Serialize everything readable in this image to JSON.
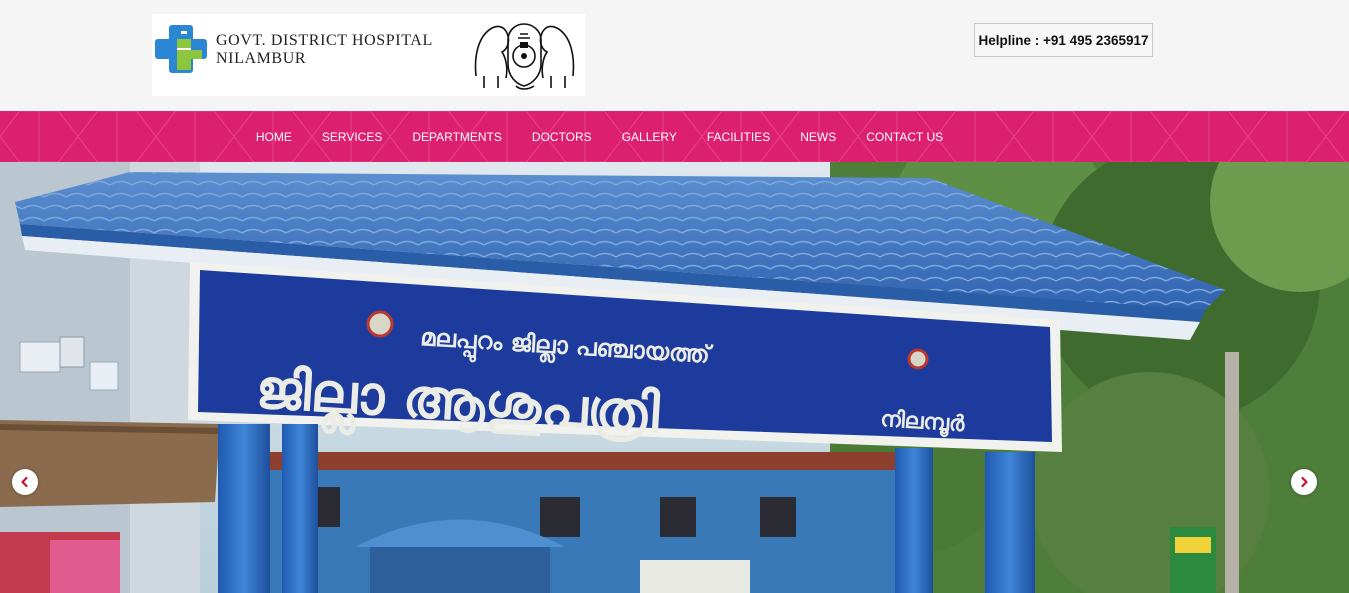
{
  "header": {
    "logo_line1": "GOVT. DISTRICT HOSPITAL",
    "logo_line2": "NILAMBUR",
    "helpline": "Helpline : +91 495 2365917"
  },
  "nav": {
    "items": [
      "HOME",
      "SERVICES",
      "DEPARTMENTS",
      "DOCTORS",
      "GALLERY",
      "FACILITIES",
      "NEWS",
      "CONTACT US"
    ]
  },
  "slider": {
    "sign_line1": "മലപ്പുറം ജില്ലാ പഞ്ചായത്ത്",
    "sign_line2": "ജില്ലാ ആശുപത്രി",
    "sign_line3": "നിലമ്പൂർ",
    "prev_icon": "chevron-left-icon",
    "next_icon": "chevron-right-icon"
  },
  "colors": {
    "nav_bg": "#dc1f6e",
    "header_bg": "#f5f5f5",
    "arrow_red": "#c8102e",
    "cross_blue": "#2b87d4",
    "cross_green": "#8cc63f"
  }
}
